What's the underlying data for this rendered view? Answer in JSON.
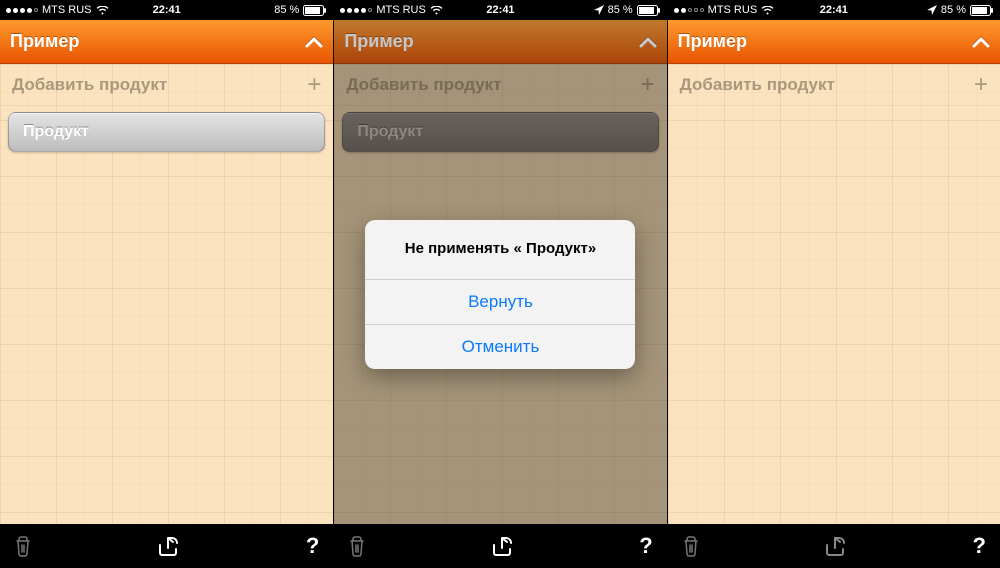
{
  "status": {
    "carrier": "MTS RUS",
    "time": "22:41",
    "battery_pct": "85 %",
    "signal_dots": 5,
    "signal_filled": 4
  },
  "navbar": {
    "title": "Пример"
  },
  "main": {
    "add_label": "Добавить продукт",
    "product_label": "Продукт"
  },
  "modal": {
    "message": "Не применять « Продукт»",
    "revert": "Вернуть",
    "cancel": "Отменить"
  }
}
